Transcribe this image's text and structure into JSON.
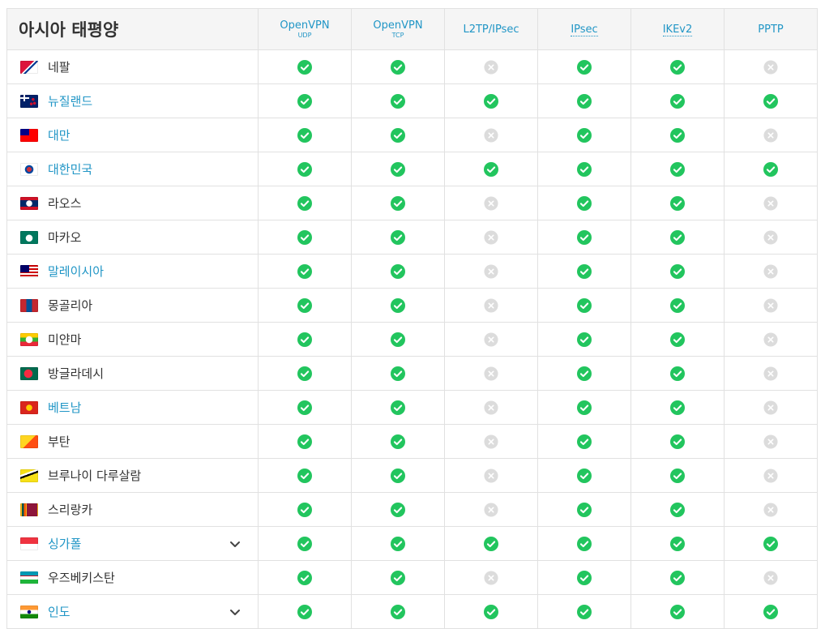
{
  "table": {
    "region_title": "아시아 태평양",
    "columns": [
      {
        "label": "OpenVPN",
        "sub": "UDP"
      },
      {
        "label": "OpenVPN",
        "sub": "TCP"
      },
      {
        "label": "L2TP/IPsec",
        "sub": ""
      },
      {
        "label": "IPsec",
        "sub": ""
      },
      {
        "label": "IKEv2",
        "sub": ""
      },
      {
        "label": "PPTP",
        "sub": ""
      }
    ],
    "rows": [
      {
        "country": "네팔",
        "flag": "nepal",
        "link": false,
        "expand": false,
        "support": [
          1,
          1,
          0,
          1,
          1,
          0
        ]
      },
      {
        "country": "뉴질랜드",
        "flag": "new-zealand",
        "link": true,
        "expand": false,
        "support": [
          1,
          1,
          1,
          1,
          1,
          1
        ]
      },
      {
        "country": "대만",
        "flag": "taiwan",
        "link": true,
        "expand": false,
        "support": [
          1,
          1,
          0,
          1,
          1,
          0
        ]
      },
      {
        "country": "대한민국",
        "flag": "south-korea",
        "link": true,
        "expand": false,
        "support": [
          1,
          1,
          1,
          1,
          1,
          1
        ]
      },
      {
        "country": "라오스",
        "flag": "laos",
        "link": false,
        "expand": false,
        "support": [
          1,
          1,
          0,
          1,
          1,
          0
        ]
      },
      {
        "country": "마카오",
        "flag": "macao",
        "link": false,
        "expand": false,
        "support": [
          1,
          1,
          0,
          1,
          1,
          0
        ]
      },
      {
        "country": "말레이시아",
        "flag": "malaysia",
        "link": true,
        "expand": false,
        "support": [
          1,
          1,
          0,
          1,
          1,
          0
        ]
      },
      {
        "country": "몽골리아",
        "flag": "mongolia",
        "link": false,
        "expand": false,
        "support": [
          1,
          1,
          0,
          1,
          1,
          0
        ]
      },
      {
        "country": "미얀마",
        "flag": "myanmar",
        "link": false,
        "expand": false,
        "support": [
          1,
          1,
          0,
          1,
          1,
          0
        ]
      },
      {
        "country": "방글라데시",
        "flag": "bangladesh",
        "link": false,
        "expand": false,
        "support": [
          1,
          1,
          0,
          1,
          1,
          0
        ]
      },
      {
        "country": "베트남",
        "flag": "vietnam",
        "link": true,
        "expand": false,
        "support": [
          1,
          1,
          0,
          1,
          1,
          0
        ]
      },
      {
        "country": "부탄",
        "flag": "bhutan",
        "link": false,
        "expand": false,
        "support": [
          1,
          1,
          0,
          1,
          1,
          0
        ]
      },
      {
        "country": "브루나이 다루살람",
        "flag": "brunei",
        "link": false,
        "expand": false,
        "support": [
          1,
          1,
          0,
          1,
          1,
          0
        ]
      },
      {
        "country": "스리랑카",
        "flag": "sri-lanka",
        "link": false,
        "expand": false,
        "support": [
          1,
          1,
          0,
          1,
          1,
          0
        ]
      },
      {
        "country": "싱가폴",
        "flag": "singapore",
        "link": true,
        "expand": true,
        "support": [
          1,
          1,
          1,
          1,
          1,
          1
        ]
      },
      {
        "country": "우즈베키스탄",
        "flag": "uzbekistan",
        "link": false,
        "expand": false,
        "support": [
          1,
          1,
          0,
          1,
          1,
          0
        ]
      },
      {
        "country": "인도",
        "flag": "india",
        "link": true,
        "expand": true,
        "support": [
          1,
          1,
          1,
          1,
          1,
          1
        ]
      }
    ]
  },
  "icons": {
    "supported": "check-circle-icon",
    "unsupported": "x-circle-icon",
    "expand": "chevron-down-icon"
  },
  "colors": {
    "accent": "#2196c6",
    "check": "#22c55e",
    "cross": "#dcdcdc",
    "text": "#333333",
    "header_bg": "#f5f5f5",
    "border": "#e1e1e1"
  }
}
